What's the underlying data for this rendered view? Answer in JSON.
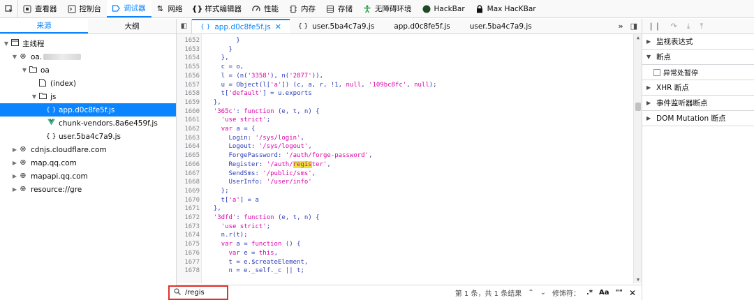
{
  "toolbar": {
    "tabs": [
      {
        "label": "查看器",
        "icon": "inspector-icon"
      },
      {
        "label": "控制台",
        "icon": "console-icon"
      },
      {
        "label": "调试器",
        "icon": "debugger-icon",
        "active": true
      },
      {
        "label": "网络",
        "icon": "network-icon"
      },
      {
        "label": "样式编辑器",
        "icon": "style-editor-icon"
      },
      {
        "label": "性能",
        "icon": "performance-icon"
      },
      {
        "label": "内存",
        "icon": "memory-icon"
      },
      {
        "label": "存储",
        "icon": "storage-icon"
      },
      {
        "label": "无障碍环境",
        "icon": "accessibility-icon"
      },
      {
        "label": "HackBar",
        "icon": "hackbar-icon"
      },
      {
        "label": "Max HacKBar",
        "icon": "max-hackbar-icon"
      }
    ]
  },
  "left": {
    "tabs": [
      "来源",
      "大纲"
    ],
    "tree": [
      {
        "label": "主线程"
      },
      {
        "label": "oa."
      },
      {
        "label": "oa"
      },
      {
        "label": "(index)"
      },
      {
        "label": "js"
      },
      {
        "label": "app.d0c8fe5f.js"
      },
      {
        "label": "chunk-vendors.8a6e459f.js"
      },
      {
        "label": "user.5ba4c7a9.js"
      },
      {
        "label": "cdnjs.cloudflare.com"
      },
      {
        "label": "map.qq.com"
      },
      {
        "label": "mapapi.qq.com"
      },
      {
        "label": "resource://gre"
      }
    ]
  },
  "editor": {
    "tabs": [
      "app.d0c8fe5f.js",
      "user.5ba4c7a9.js",
      "app.d0c8fe5f.js",
      "user.5ba4c7a9.js"
    ],
    "lines": [
      {
        "n": "1652",
        "t": "        }"
      },
      {
        "n": "1653",
        "t": "      }"
      },
      {
        "n": "1654",
        "t": "    },"
      },
      {
        "n": "1655",
        "t": "    c = o,"
      },
      {
        "n": "1656",
        "t": "    l = (n('3358'), n('2877')),"
      },
      {
        "n": "1657",
        "t": "    u = Object(l['a']) (c, a, r, !1, null, '109bc8fc', null);"
      },
      {
        "n": "1658",
        "t": "    t['default'] = u.exports"
      },
      {
        "n": "1659",
        "t": "  },"
      },
      {
        "n": "1660",
        "t": "  '365c': function (e, t, n) {"
      },
      {
        "n": "1661",
        "t": "    'use strict';"
      },
      {
        "n": "1662",
        "t": "    var a = {"
      },
      {
        "n": "1663",
        "t": "      Login: '/sys/login',"
      },
      {
        "n": "1664",
        "t": "      Logout: '/sys/logout',"
      },
      {
        "n": "1665",
        "t": "      ForgePassword: '/auth/forge-password',"
      },
      {
        "n": "1666",
        "t": "      Register: '/auth/register',"
      },
      {
        "n": "1667",
        "t": "      SendSms: '/public/sms',"
      },
      {
        "n": "1668",
        "t": "      UserInfo: '/user/info'"
      },
      {
        "n": "1669",
        "t": "    };"
      },
      {
        "n": "1670",
        "t": "    t['a'] = a"
      },
      {
        "n": "1671",
        "t": "  },"
      },
      {
        "n": "1672",
        "t": "  '3dfd': function (e, t, n) {"
      },
      {
        "n": "1673",
        "t": "    'use strict';"
      },
      {
        "n": "1674",
        "t": "    n.r(t);"
      },
      {
        "n": "1675",
        "t": "    var a = function () {"
      },
      {
        "n": "1676",
        "t": "      var e = this,"
      },
      {
        "n": "1677",
        "t": "      t = e.$createElement,"
      },
      {
        "n": "1678",
        "t": "      n = e._self._c || t;"
      }
    ],
    "highlight": "regis",
    "search": {
      "value": "/regis",
      "result": "第 1 条，共 1 条结果",
      "modifiers_label": "修饰符：",
      "regex": ".*",
      "case": "Aa",
      "whole": "\"\"",
      "close": "✕"
    }
  },
  "right": {
    "sections": [
      {
        "label": "监视表达式",
        "open": false
      },
      {
        "label": "断点",
        "open": true
      },
      {
        "label": "XHR 断点",
        "open": false
      },
      {
        "label": "事件监听器断点",
        "open": false
      },
      {
        "label": "DOM Mutation 断点",
        "open": false
      }
    ],
    "pause_on_exceptions": "异常处暂停"
  },
  "colors": {
    "accent": "#0a84ff",
    "search_outline": "#e0312b",
    "highlight": "#e8e33b"
  }
}
